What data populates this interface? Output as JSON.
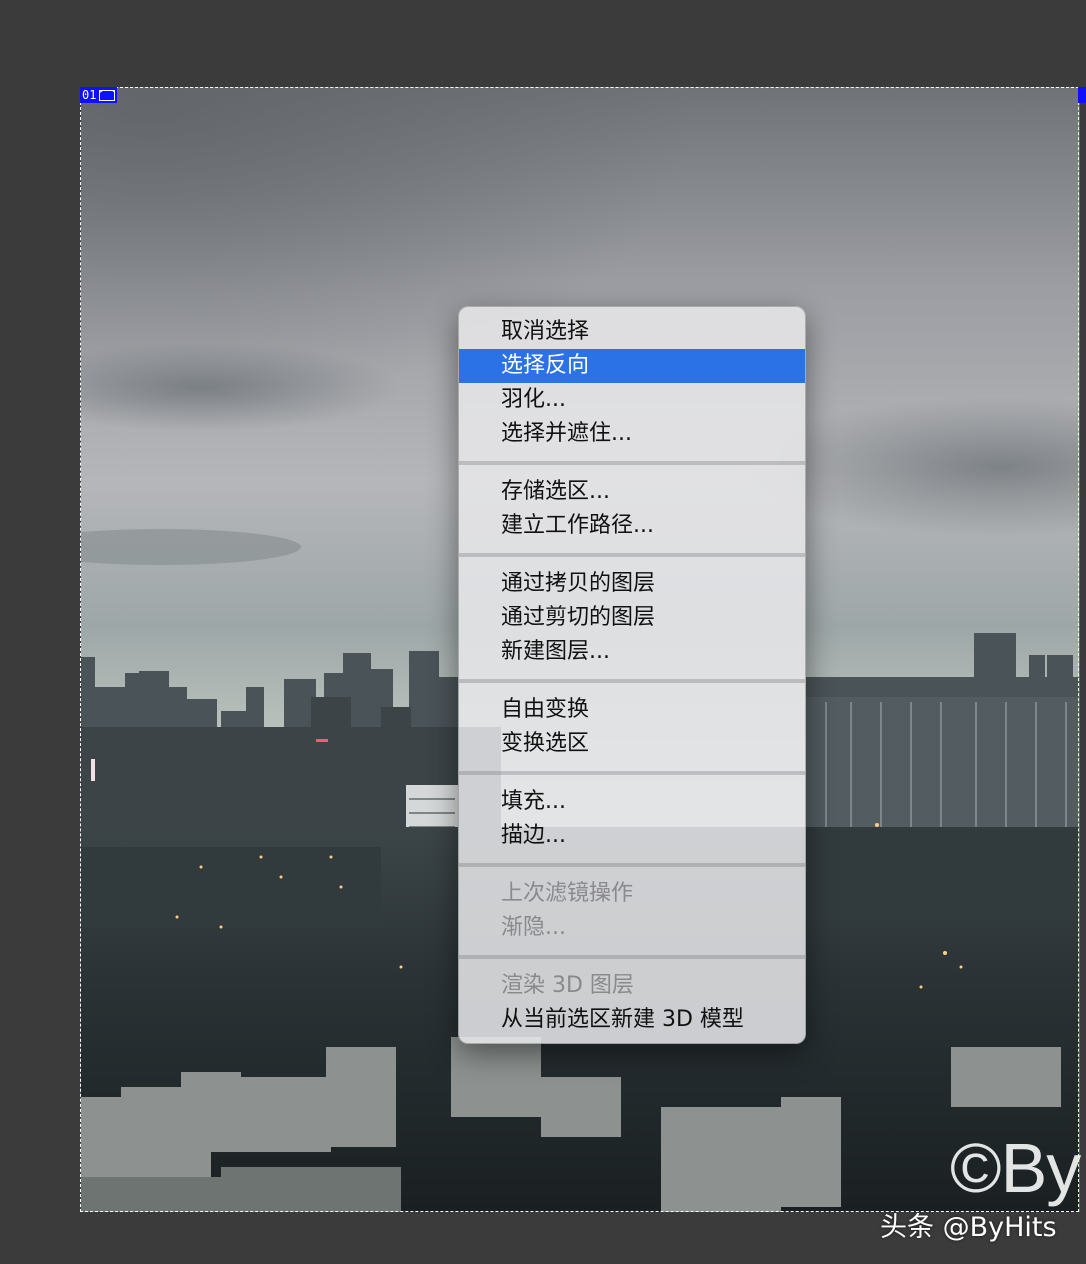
{
  "slice_tag": {
    "label": "01"
  },
  "context_menu": {
    "groups": [
      [
        {
          "label": "取消选择",
          "state": "normal"
        },
        {
          "label": "选择反向",
          "state": "highlighted"
        },
        {
          "label": "羽化...",
          "state": "normal"
        },
        {
          "label": "选择并遮住...",
          "state": "normal"
        }
      ],
      [
        {
          "label": "存储选区...",
          "state": "normal"
        },
        {
          "label": "建立工作路径...",
          "state": "normal"
        }
      ],
      [
        {
          "label": "通过拷贝的图层",
          "state": "normal"
        },
        {
          "label": "通过剪切的图层",
          "state": "normal"
        },
        {
          "label": "新建图层...",
          "state": "normal"
        }
      ],
      [
        {
          "label": "自由变换",
          "state": "normal"
        },
        {
          "label": "变换选区",
          "state": "normal"
        }
      ],
      [
        {
          "label": "填充...",
          "state": "normal"
        },
        {
          "label": "描边...",
          "state": "normal"
        }
      ],
      [
        {
          "label": "上次滤镜操作",
          "state": "disabled"
        },
        {
          "label": "渐隐...",
          "state": "disabled"
        }
      ],
      [
        {
          "label": "渲染 3D 图层",
          "state": "disabled"
        },
        {
          "label": "从当前选区新建 3D 模型",
          "state": "normal"
        }
      ]
    ]
  },
  "watermark": {
    "large": "©By",
    "small": "头条 @ByHits"
  },
  "colors": {
    "highlight": "#2b72e6",
    "selection_slice": "#1010ff"
  }
}
